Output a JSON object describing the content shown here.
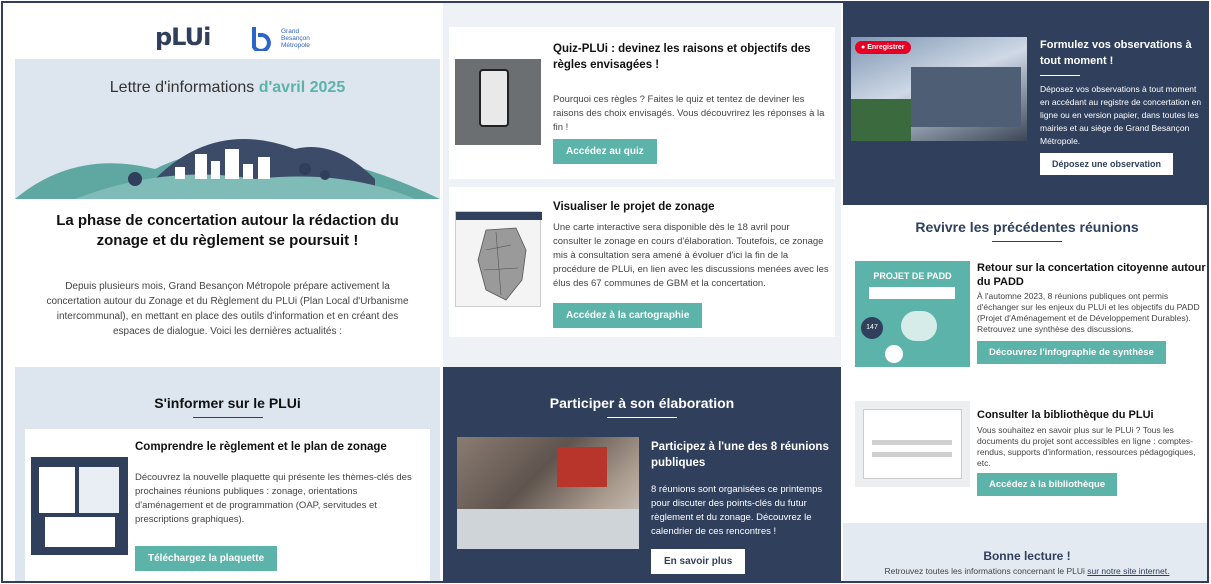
{
  "brand": {
    "plui_logo": "pLUi",
    "gbm_logo_line1": "Grand",
    "gbm_logo_line2": "Besançon",
    "gbm_logo_line3": "Métropole"
  },
  "newsletter": {
    "title_prefix": "Lettre d'informations ",
    "title_accent": "d'avril 2025",
    "headline": "La phase de concertation autour la rédaction du zonage et du règlement se poursuit !",
    "intro": "Depuis plusieurs mois, Grand Besançon Métropole prépare activement la concertation autour du Zonage et du Règlement du PLUi (Plan Local d'Urbanisme intercommunal), en mettant en place des outils d'information et en créant des espaces de dialogue. Voici les dernières actualités :"
  },
  "informer": {
    "heading": "S'informer sur le PLUi",
    "card_title": "Comprendre le règlement et le plan de zonage",
    "card_text": "Découvrez la nouvelle plaquette qui présente les thèmes-clés des prochaines réunions publiques : zonage, orientations d'aménagement et de programmation (OAP, servitudes et prescriptions graphiques).",
    "button": "Téléchargez la plaquette"
  },
  "quiz": {
    "title": "Quiz-PLUi : devinez les raisons et objectifs des règles envisagées !",
    "text": "Pourquoi ces règles ? Faites le quiz et tentez de deviner les raisons des choix envisagés. Vous découvrirez les réponses à la fin !",
    "button": "Accédez au quiz"
  },
  "zonage": {
    "title": "Visualiser le projet de zonage",
    "text": "Une carte interactive sera disponible dès le 18 avril pour consulter le zonage en cours d'élaboration. Toutefois, ce zonage mis à consultation sera amené à évoluer d'ici la fin de la procédure de PLUi, en lien avec les discussions menées avec les élus des 67 communes de GBM et la concertation.",
    "button": "Accédez à la cartographie"
  },
  "participer": {
    "heading": "Participer à son élaboration",
    "card_title": "Participez à l'une des 8 réunions publiques",
    "card_text": "8 réunions sont organisées ce printemps pour discuter des points-clés du futur règlement et du zonage. Découvrez le calendrier de ces rencontres !",
    "button": "En savoir plus"
  },
  "observations": {
    "pin_label": "Enregistrer",
    "title": "Formulez vos observations à tout moment !",
    "text": "Déposez vos observations à tout moment en accédant au registre de concertation en ligne ou en version papier, dans toutes les mairies et au siège de Grand Besançon Métropole.",
    "button": "Déposez une observation"
  },
  "reunions": {
    "heading": "Revivre les précédentes réunions",
    "padd_title": "Retour sur la concertation citoyenne autour du PADD",
    "padd_text": "À l'automne 2023, 8 réunions publiques ont permis d'échanger sur les enjeux du PLUi et les objectifs du PADD (Projet d'Aménagement et de Développement Durables). Retrouvez une synthèse des discussions.",
    "padd_button": "Découvrez l'infographie de synthèse",
    "padd_thumb_title": "PROJET DE PADD",
    "padd_thumb_num": "147",
    "biblio_title": "Consulter la bibliothèque du PLUi",
    "biblio_text": "Vous souhaitez en savoir plus sur le PLUi ? Tous les documents du projet sont accessibles en ligne : comptes-rendus, supports d'information, ressources pédagogiques, etc.",
    "biblio_button": "Accédez à la bibliothèque"
  },
  "footer": {
    "title": "Bonne lecture !",
    "text": "Retrouvez toutes les informations concernant le PLUi ",
    "link": "sur notre site internet."
  },
  "colors": {
    "navy": "#2f3f5c",
    "teal": "#5bb3a9",
    "pin_red": "#e60023"
  }
}
